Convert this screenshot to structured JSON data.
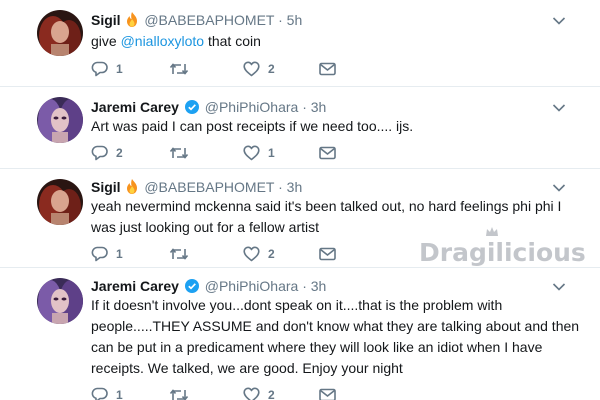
{
  "colors": {
    "text": "#14171a",
    "secondary": "#657786",
    "link": "#1b95e0",
    "verified": "#1da1f2",
    "divider": "#e6ecf0",
    "watermark": "#c3c6cb"
  },
  "watermark": {
    "text": "Dragilicious"
  },
  "tweets": [
    {
      "name": "Sigil",
      "handle": "@BABEBAPHOMET",
      "time": "· 5h",
      "badge_icon": "fire-emoji-icon",
      "avatar": "avatar-sigil",
      "body_prefix": "give ",
      "mention": "@nialloxyloto",
      "body_suffix": " that coin",
      "reply_count": "1",
      "like_count": "2"
    },
    {
      "name": "Jaremi Carey",
      "handle": "@PhiPhiOhara",
      "time": "· 3h",
      "badge_icon": "verified-badge-icon",
      "avatar": "avatar-jaremi",
      "lines": [
        "Art was paid I can post receipts if we need too.... ijs."
      ],
      "reply_count": "2",
      "like_count": "1"
    },
    {
      "name": "Sigil",
      "handle": "@BABEBAPHOMET",
      "time": "· 3h",
      "badge_icon": "fire-emoji-icon",
      "avatar": "avatar-sigil",
      "lines": [
        "yeah nevermind mckenna said it's been talked out, no hard feelings phi phi I",
        "was just looking out for a fellow artist"
      ],
      "reply_count": "1",
      "like_count": "2"
    },
    {
      "name": "Jaremi Carey",
      "handle": "@PhiPhiOhara",
      "time": "· 3h",
      "badge_icon": "verified-badge-icon",
      "avatar": "avatar-jaremi",
      "lines": [
        "If it doesn't involve you...dont speak on it....that is the problem with",
        "people.....THEY ASSUME and don't know what they are talking about and then",
        "can be put in a predicament where they will look like an idiot when I have",
        "receipts. We talked, we are good. Enjoy your night"
      ],
      "reply_count": "1",
      "like_count": "2"
    }
  ]
}
